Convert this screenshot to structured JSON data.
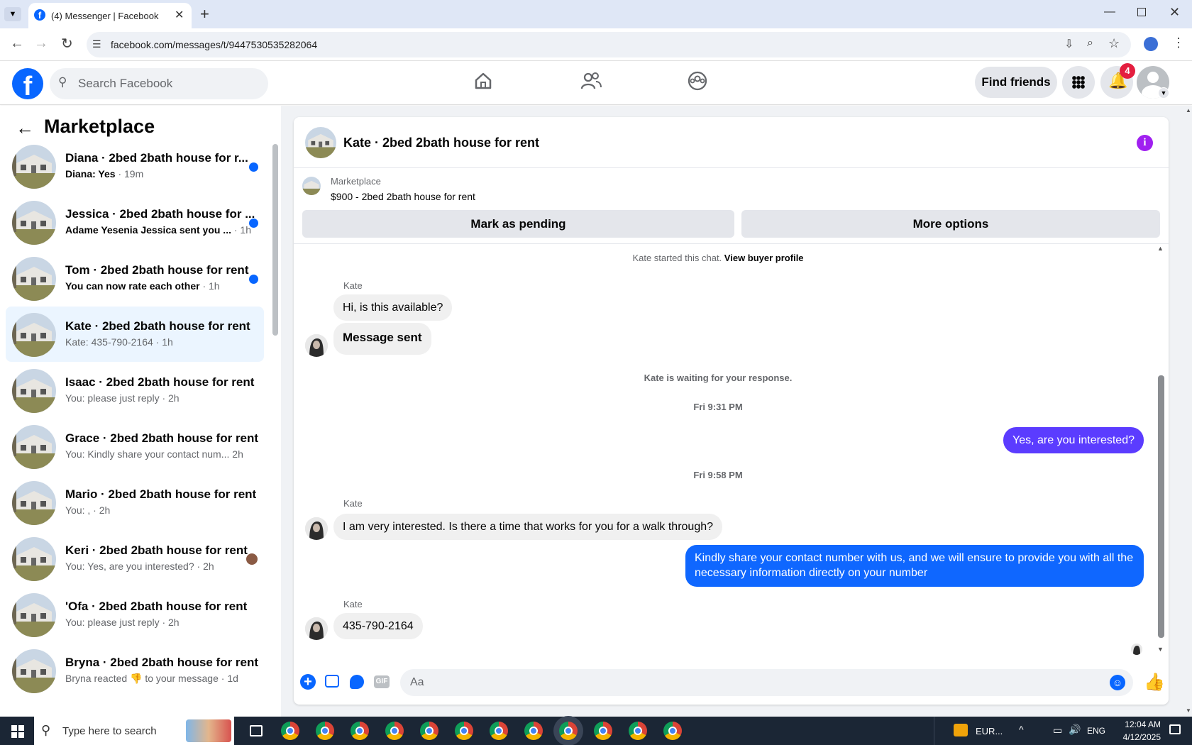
{
  "browser": {
    "tab_title": "(4) Messenger | Facebook",
    "url": "facebook.com/messages/t/9447530535282064"
  },
  "header": {
    "search_placeholder": "Search Facebook",
    "find_friends": "Find friends",
    "notification_count": "4"
  },
  "sidebar": {
    "title": "Marketplace",
    "conversations": [
      {
        "name": "Diana · 2bed 2bath house for r...",
        "preview": "Diana: Yes",
        "time": " · 19m",
        "unread": true
      },
      {
        "name": "Jessica · 2bed 2bath house for ...",
        "preview": "Adame Yesenia Jessica sent you ...",
        "time": " · 1h",
        "unread": true
      },
      {
        "name": "Tom · 2bed 2bath house for rent",
        "preview": "You can now rate each other",
        "time": " · 1h",
        "unread": true
      },
      {
        "name": "Kate · 2bed 2bath house for rent",
        "preview": "Kate: 435-790-2164",
        "time": " · 1h",
        "unread": false,
        "selected": true
      },
      {
        "name": "Isaac · 2bed 2bath house for rent",
        "preview": "You: please just reply",
        "time": " · 2h",
        "unread": false
      },
      {
        "name": "Grace · 2bed 2bath house for rent",
        "preview": "You: Kindly share your contact num...",
        "time": " 2h",
        "unread": false
      },
      {
        "name": "Mario · 2bed 2bath house for rent",
        "preview": "You: ,",
        "time": " · 2h",
        "unread": false
      },
      {
        "name": "Keri · 2bed 2bath house for rent",
        "preview": "You: Yes, are you interested?",
        "time": " · 2h",
        "unread": false
      },
      {
        "name": "'Ofa · 2bed 2bath house for rent",
        "preview": "You: please just reply",
        "time": " · 2h",
        "unread": false
      },
      {
        "name": "Bryna · 2bed 2bath house for rent",
        "preview": "Bryna reacted 👎 to your message",
        "time": " · 1d",
        "unread": false
      }
    ]
  },
  "chat": {
    "title": "Kate · 2bed 2bath house for rent",
    "listing_source": "Marketplace",
    "listing_title": "$900 - 2bed 2bath house for rent",
    "mark_pending": "Mark as pending",
    "more_options": "More options",
    "started": "Kate started this chat. ",
    "view_profile": "View buyer profile",
    "sender1": "Kate",
    "msg1": "Hi, is this available?",
    "msg2": "Message sent",
    "waiting": "Kate is waiting for your response.",
    "time1": "Fri 9:31 PM",
    "out1": "Yes, are you interested?",
    "time2": "Fri 9:58 PM",
    "sender2": "Kate",
    "msg3": "I am very interested. Is there a time that works for you for a walk through?",
    "out2": "Kindly share your contact number with us, and we will ensure to provide you with all the necessary information directly on your number",
    "sender3": "Kate",
    "msg4": "435-790-2164",
    "composer_placeholder": "Aa"
  },
  "taskbar": {
    "search_placeholder": "Type here to search",
    "tray_app": "EUR...",
    "lang": "ENG",
    "time": "12:04 AM",
    "date": "4/12/2025"
  },
  "colors": {
    "fb_blue": "#0866ff",
    "outgoing_purple": "#5b3cff",
    "outgoing_blue": "#0f67ff",
    "accent_purple": "#a020f0"
  }
}
